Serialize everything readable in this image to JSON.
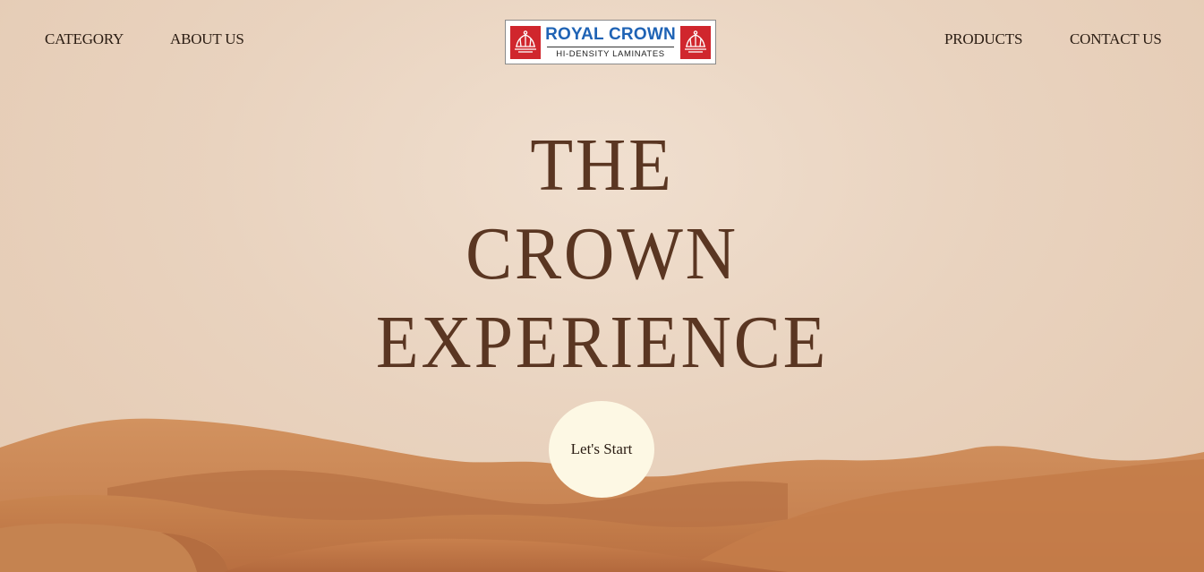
{
  "nav": {
    "left": [
      {
        "label": "CATEGORY"
      },
      {
        "label": "ABOUT US"
      }
    ],
    "right": [
      {
        "label": "PRODUCTS"
      },
      {
        "label": "CONTACT US"
      }
    ]
  },
  "logo": {
    "title": "ROYAL CROWN",
    "subtitle": "HI-DENSITY  LAMINATES",
    "colors": {
      "title": "#1f63b5",
      "badge": "#d0262d"
    }
  },
  "hero": {
    "line1": "THE",
    "line2": "CROWN",
    "line3": "EXPERIENCE",
    "cta_label": "Let's Start"
  },
  "theme": {
    "headline_color": "#5a3622",
    "cta_background": "#fdf8e4",
    "sand_color": "#c07a4c"
  }
}
